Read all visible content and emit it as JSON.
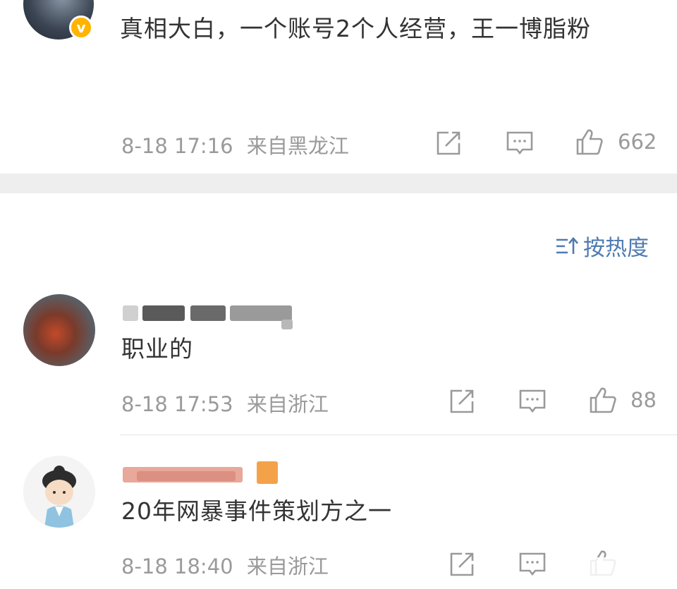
{
  "post": {
    "text": "真相大白，一个账号2个人经营，王一博脂粉",
    "time": "8-18 17:16",
    "location": "来自黑龙江",
    "likes": "662",
    "badge": "v"
  },
  "sort": {
    "label": "按热度"
  },
  "comments": [
    {
      "text": "职业的",
      "time": "8-18 17:53",
      "location": "来自浙江",
      "likes": "88"
    },
    {
      "text": "20年网暴事件策划方之一",
      "time": "8-18 18:40",
      "location": "来自浙江",
      "likes": ""
    }
  ],
  "colors": {
    "meta_gray": "#9a9a9a",
    "link_blue": "#4f7bb0",
    "divider": "#eeeeee",
    "vip_badge": "#ffb400"
  }
}
